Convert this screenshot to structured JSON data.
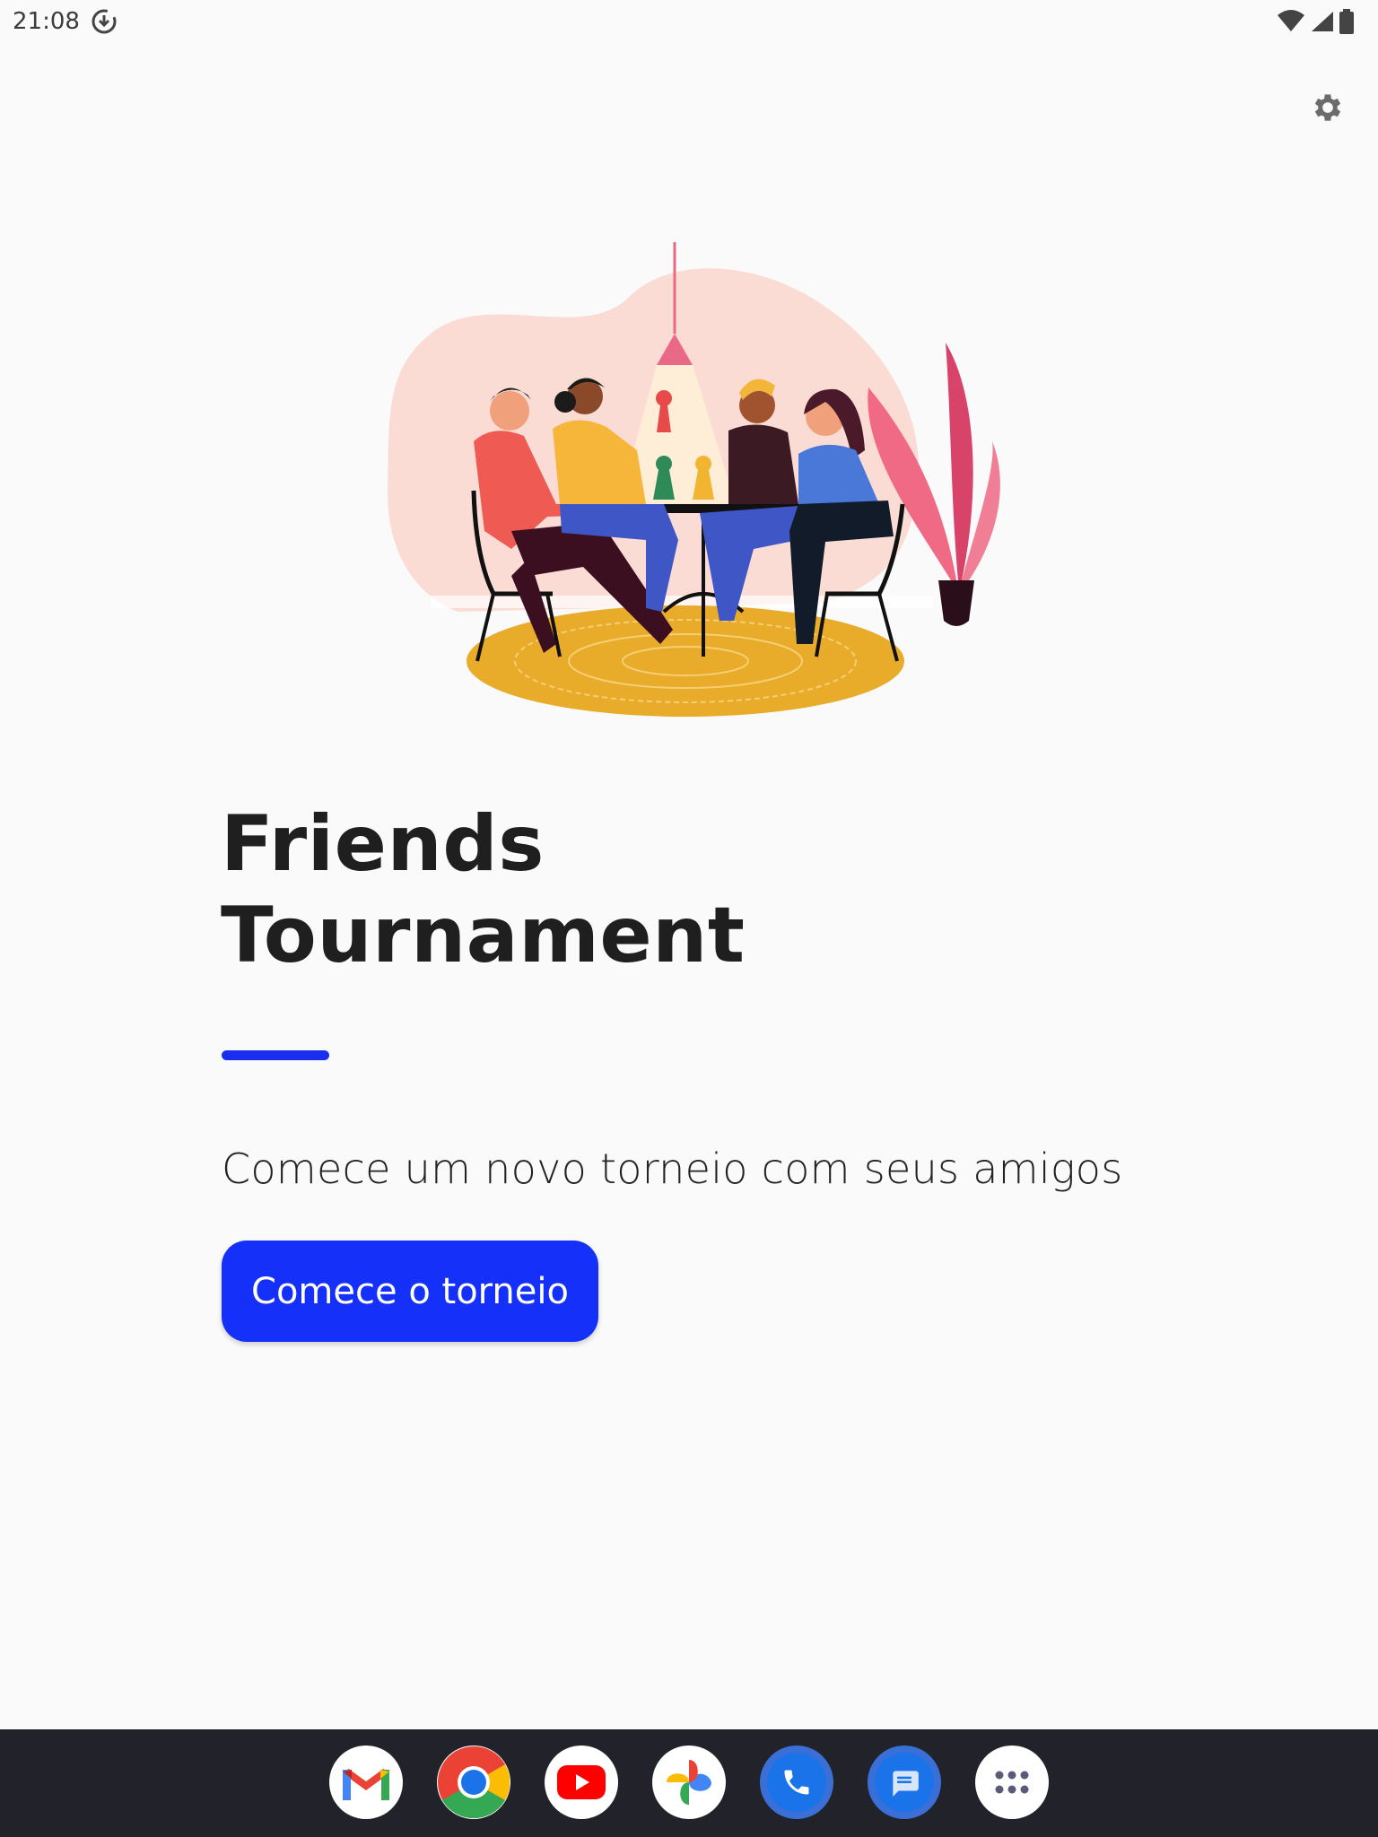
{
  "status_bar": {
    "time": "21:08",
    "download_icon": "download-circle-icon",
    "wifi_icon": "wifi-icon",
    "signal_icon": "cell-signal-icon",
    "battery_icon": "battery-icon"
  },
  "toolbar": {
    "settings_icon": "gear-icon"
  },
  "hero": {
    "illustration": "friends-playing-board-game-illustration"
  },
  "main": {
    "title_line1": "Friends",
    "title_line2": "Tournament",
    "subtitle": "Comece um novo torneio com seus amigos",
    "start_button_label": "Comece o torneio",
    "accent_color": "#1531f9"
  },
  "dock": {
    "apps": [
      {
        "name": "gmail",
        "icon": "gmail-icon"
      },
      {
        "name": "chrome",
        "icon": "chrome-icon"
      },
      {
        "name": "youtube",
        "icon": "youtube-icon"
      },
      {
        "name": "photos",
        "icon": "photos-pinwheel-icon"
      },
      {
        "name": "phone",
        "icon": "phone-icon"
      },
      {
        "name": "messages",
        "icon": "messages-icon"
      },
      {
        "name": "app-drawer",
        "icon": "app-grid-icon"
      }
    ]
  }
}
